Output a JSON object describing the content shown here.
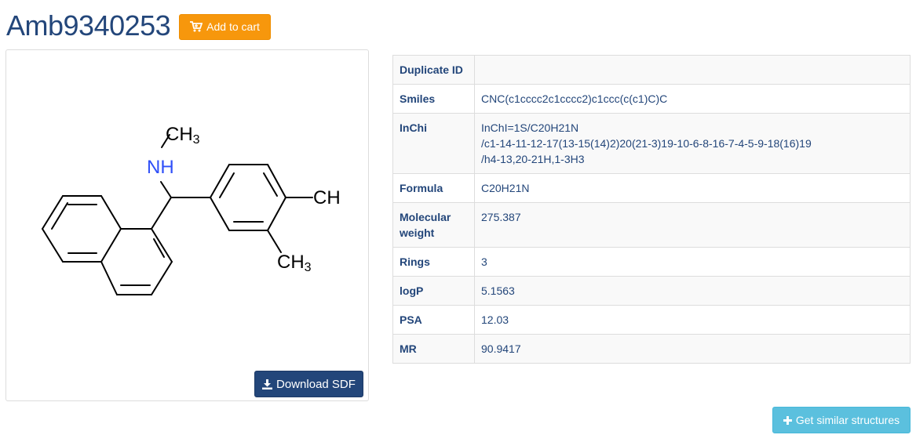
{
  "compound": {
    "id": "Amb9340253",
    "add_to_cart_label": "Add to cart"
  },
  "structure": {
    "atoms": {
      "ch3_top": "CH",
      "ch3_top_sub": "3",
      "nh": "NH",
      "ch_right": "CH",
      "ch3_bottom": "CH",
      "ch3_bottom_sub": "3"
    },
    "colors": {
      "bond": "#000000",
      "nitrogen": "#3050f8"
    },
    "download_label": "Download SDF"
  },
  "properties": {
    "rows": [
      {
        "label": "Duplicate ID",
        "value": ""
      },
      {
        "label": "Smiles",
        "value": "CNC(c1cccc2c1cccc2)c1ccc(c(c1)C)C"
      },
      {
        "label": "InChi",
        "lines": [
          "InChI=1S/C20H21N",
          "/c1-14-11-12-17(13-15(14)2)20(21-3)19-10-6-8-16-7-4-5-9-18(16)19",
          "/h4-13,20-21H,1-3H3"
        ]
      },
      {
        "label": "Formula",
        "value": "C20H21N"
      },
      {
        "label": "Molecular weight",
        "value": "275.387"
      },
      {
        "label": "Rings",
        "value": "3"
      },
      {
        "label": "logP",
        "value": "5.1563"
      },
      {
        "label": "PSA",
        "value": "12.03"
      },
      {
        "label": "MR",
        "value": "90.9417"
      }
    ]
  },
  "similar_button_label": "Get similar structures",
  "icons": {
    "cart": "cart-icon",
    "download": "download-icon",
    "plus": "plus-icon"
  },
  "theme": {
    "primary": "#23467a",
    "cart_orange": "#f7970c",
    "info_blue": "#5bc0de"
  }
}
